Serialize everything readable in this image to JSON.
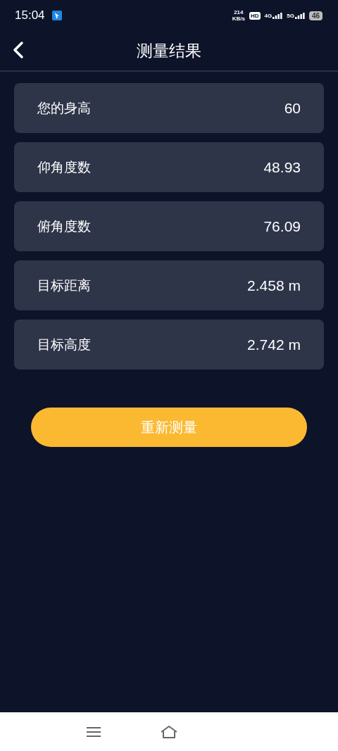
{
  "status_bar": {
    "time": "15:04",
    "net_speed": "214",
    "net_unit": "KB/s",
    "hd": "HD",
    "sim_1": "4G",
    "sim_2": "5G",
    "battery": "46"
  },
  "header": {
    "title": "测量结果"
  },
  "results": [
    {
      "label": "您的身高",
      "value": "60"
    },
    {
      "label": "仰角度数",
      "value": "48.93"
    },
    {
      "label": "俯角度数",
      "value": "76.09"
    },
    {
      "label": "目标距离",
      "value": "2.458 m"
    },
    {
      "label": "目标高度",
      "value": "2.742 m"
    }
  ],
  "action_button": {
    "label": "重新测量"
  }
}
